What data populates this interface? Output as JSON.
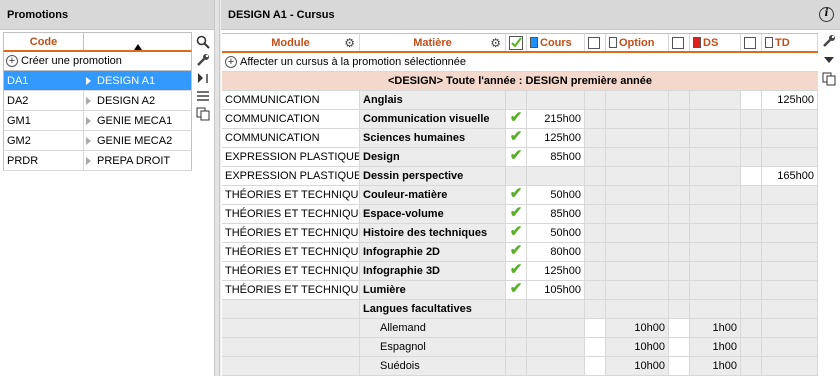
{
  "left": {
    "title": "Promotions",
    "col_code": "Code",
    "create_label": "Créer une promotion",
    "rows": [
      {
        "code": "DA1",
        "label": "DESIGN A1",
        "selected": true
      },
      {
        "code": "DA2",
        "label": "DESIGN A2",
        "selected": false
      },
      {
        "code": "GM1",
        "label": "GENIE MECA1",
        "selected": false
      },
      {
        "code": "GM2",
        "label": "GENIE MECA2",
        "selected": false
      },
      {
        "code": "PRDR",
        "label": "PREPA DROIT",
        "selected": false
      }
    ]
  },
  "right": {
    "title": "DESIGN A1 - Cursus",
    "headers": {
      "module": "Module",
      "matiere": "Matière",
      "cours": "Cours",
      "option": "Option",
      "ds": "DS",
      "td": "TD"
    },
    "colors": {
      "cours": "#1e90ff",
      "option": "#ffffff",
      "ds": "#e0201a",
      "td": "#ffffff",
      "accent": "#e06a1a",
      "check": "#5ab02a"
    },
    "affect_label": "Affecter un cursus à la promotion sélectionnée",
    "banner": "<DESIGN> Toute l'année : DESIGN première année",
    "rows": [
      {
        "module": "COMMUNICATION",
        "matiere": "Anglais",
        "check": false,
        "cours": "",
        "option": "",
        "ds": "",
        "td": "125h00"
      },
      {
        "module": "COMMUNICATION",
        "matiere": "Communication visuelle",
        "check": true,
        "cours": "215h00",
        "option": "",
        "ds": "",
        "td": ""
      },
      {
        "module": "COMMUNICATION",
        "matiere": "Sciences humaines",
        "check": true,
        "cours": "125h00",
        "option": "",
        "ds": "",
        "td": ""
      },
      {
        "module": "EXPRESSION PLASTIQUE",
        "matiere": "Design",
        "check": true,
        "cours": "85h00",
        "option": "",
        "ds": "",
        "td": ""
      },
      {
        "module": "EXPRESSION PLASTIQUE",
        "matiere": "Dessin perspective",
        "check": false,
        "cours": "",
        "option": "",
        "ds": "",
        "td": "165h00"
      },
      {
        "module": "THÉORIES ET TECHNIQUES",
        "matiere": "Couleur-matière",
        "check": true,
        "cours": "50h00",
        "option": "",
        "ds": "",
        "td": ""
      },
      {
        "module": "THÉORIES ET TECHNIQUES",
        "matiere": "Espace-volume",
        "check": true,
        "cours": "85h00",
        "option": "",
        "ds": "",
        "td": ""
      },
      {
        "module": "THÉORIES ET TECHNIQUES",
        "matiere": "Histoire des techniques",
        "check": true,
        "cours": "50h00",
        "option": "",
        "ds": "",
        "td": ""
      },
      {
        "module": "THÉORIES ET TECHNIQUES",
        "matiere": "Infographie 2D",
        "check": true,
        "cours": "80h00",
        "option": "",
        "ds": "",
        "td": ""
      },
      {
        "module": "THÉORIES ET TECHNIQUES",
        "matiere": "Infographie 3D",
        "check": true,
        "cours": "125h00",
        "option": "",
        "ds": "",
        "td": ""
      },
      {
        "module": "THÉORIES ET TECHNIQUES",
        "matiere": "Lumière",
        "check": true,
        "cours": "105h00",
        "option": "",
        "ds": "",
        "td": ""
      }
    ],
    "group": {
      "label": "Langues facultatives",
      "items": [
        {
          "label": "Allemand",
          "option": "10h00",
          "ds": "1h00"
        },
        {
          "label": "Espagnol",
          "option": "10h00",
          "ds": "1h00"
        },
        {
          "label": "Suédois",
          "option": "10h00",
          "ds": "1h00"
        }
      ]
    }
  }
}
